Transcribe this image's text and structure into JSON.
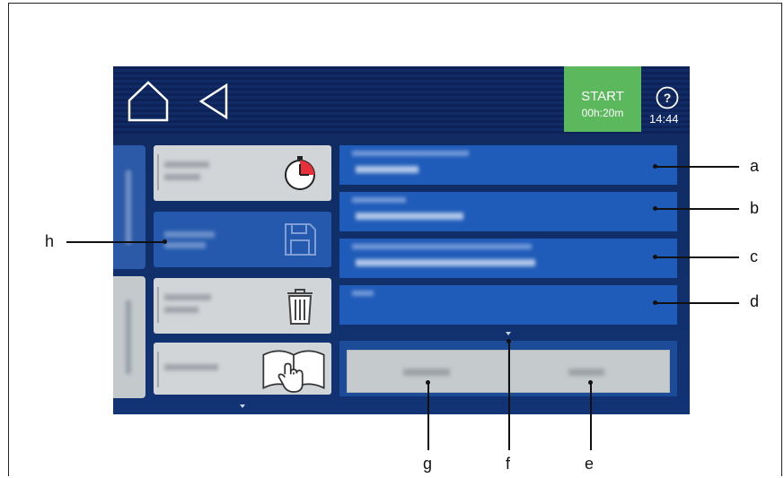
{
  "header": {
    "start_label": "START",
    "start_time": "00h:20m",
    "help_symbol": "?",
    "clock": "14:44"
  },
  "icons": {
    "home": "home-icon",
    "back": "back-arrow-icon",
    "help": "help-icon",
    "timer": "timer-icon",
    "save": "floppy-disk-icon",
    "delete": "trash-icon",
    "manual": "manual-book-icon"
  },
  "colors": {
    "start": "#5cb85c",
    "field": "#1f5bb8",
    "tile_gray": "#d2d5d7",
    "tile_blue": "#2559ad",
    "timer_accent": "#e8303a"
  },
  "callouts": {
    "a": "a",
    "b": "b",
    "c": "c",
    "d": "d",
    "e": "e",
    "f": "f",
    "g": "g",
    "h": "h"
  }
}
